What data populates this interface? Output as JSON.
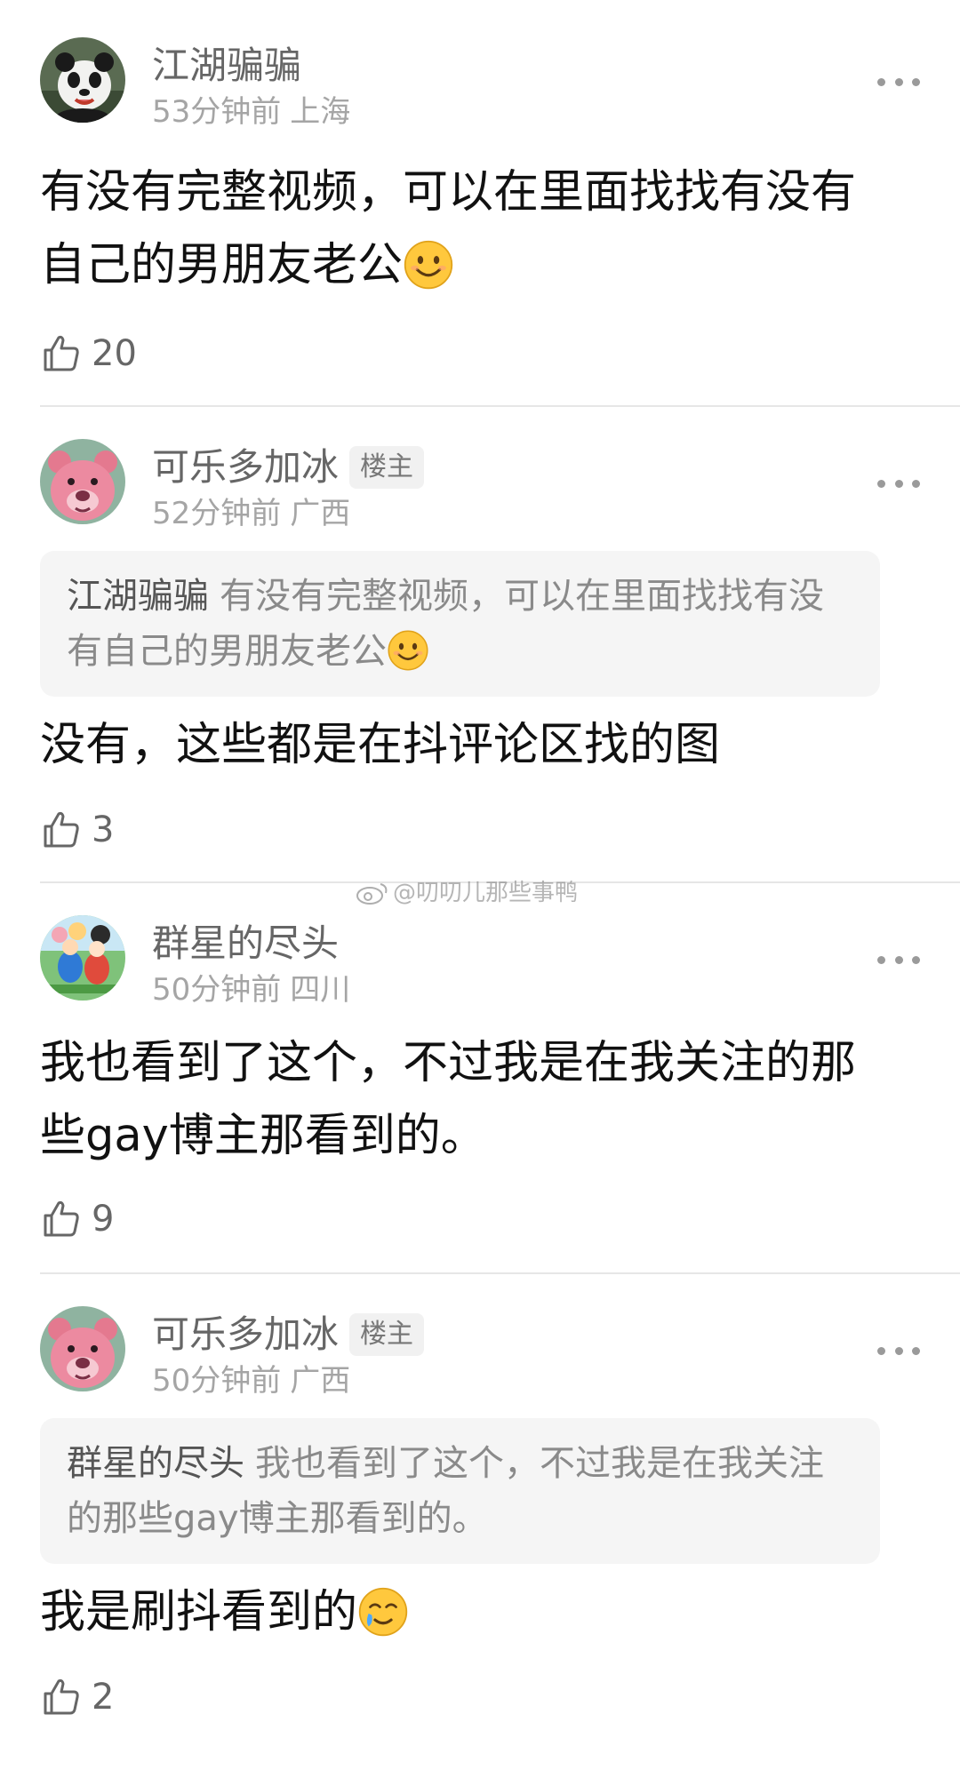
{
  "comments": [
    {
      "user": "江湖骗骗",
      "badge": "",
      "time": "53分钟前",
      "location": "上海",
      "text": "有没有完整视频，可以在里面找找有没有自己的男朋友老公",
      "text_emoji": "smile-emoji",
      "likes": "20"
    },
    {
      "user": "可乐多加冰",
      "badge": "楼主",
      "time": "52分钟前",
      "location": "广西",
      "quote_author": "江湖骗骗",
      "quote_text": "有没有完整视频，可以在里面找找有没有自己的男朋友老公",
      "quote_emoji": "smile-emoji",
      "text": "没有，这些都是在抖评论区找的图",
      "likes": "3"
    },
    {
      "user": "群星的尽头",
      "badge": "",
      "time": "50分钟前",
      "location": "四川",
      "text": "我也看到了这个，不过我是在我关注的那些gay博主那看到的。",
      "likes": "9"
    },
    {
      "user": "可乐多加冰",
      "badge": "楼主",
      "time": "50分钟前",
      "location": "广西",
      "quote_author": "群星的尽头",
      "quote_text": "我也看到了这个，不过我是在我关注的那些gay博主那看到的。",
      "text": "我是刷抖看到的",
      "text_emoji": "tearful-smile-emoji",
      "likes": "2"
    }
  ],
  "watermark": "@叨叨儿那些事鸭",
  "icons": {
    "like": "thumbs-up-outline-icon",
    "more": "more-dots-icon",
    "watermark": "weibo-logo-icon"
  },
  "colors": {
    "name": "#666666",
    "meta": "#a5a5a5",
    "quote_bg": "#f5f5f5",
    "badge_bg": "#f1f1f1",
    "emoji": "#ffc83d"
  }
}
